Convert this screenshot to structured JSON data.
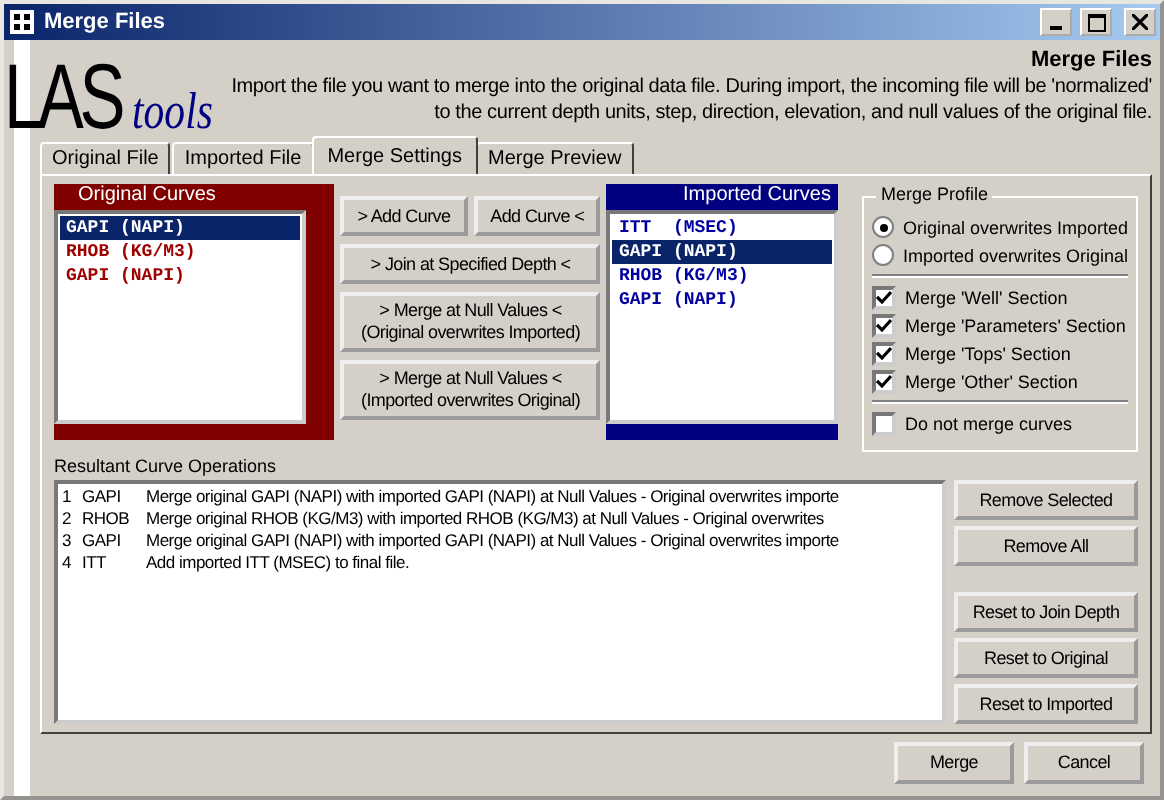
{
  "window": {
    "title": "Merge Files"
  },
  "logo": {
    "main": "LAS",
    "sub": "tools"
  },
  "header": {
    "title": "Merge Files",
    "description": "Import the file you want to merge into the original data file.  During import, the incoming file will be 'normalized' to the current depth units, step, direction, elevation, and null values of the original file."
  },
  "tabs": [
    {
      "label": "Original File",
      "selected": false
    },
    {
      "label": "Imported File",
      "selected": false
    },
    {
      "label": "Merge Settings",
      "selected": true
    },
    {
      "label": "Merge Preview",
      "selected": false
    }
  ],
  "original_curves": {
    "title": "Original Curves",
    "items": [
      {
        "label": "GAPI (NAPI)",
        "selected": true
      },
      {
        "label": "RHOB (KG/M3)",
        "selected": false
      },
      {
        "label": "GAPI (NAPI)",
        "selected": false
      }
    ]
  },
  "imported_curves": {
    "title": "Imported Curves",
    "items": [
      {
        "label": "ITT  (MSEC)",
        "selected": false
      },
      {
        "label": "GAPI (NAPI)",
        "selected": true
      },
      {
        "label": "RHOB (KG/M3)",
        "selected": false
      },
      {
        "label": "GAPI (NAPI)",
        "selected": false
      }
    ]
  },
  "curve_buttons": [
    [
      "> Add Curve",
      "Add Curve <"
    ],
    [
      "> Join at Specified Depth <"
    ],
    [
      "> Merge at Null Values <",
      "(Original overwrites Imported)"
    ],
    [
      "> Merge at Null Values <",
      "(Imported overwrites Original)"
    ]
  ],
  "merge_profile": {
    "title": "Merge Profile",
    "options": [
      {
        "kind": "radio",
        "label": "Original overwrites Imported",
        "selected": true
      },
      {
        "kind": "radio",
        "label": "Imported overwrites Original",
        "selected": false
      },
      {
        "kind": "separator"
      },
      {
        "kind": "checkbox",
        "label": "Merge 'Well' Section",
        "checked": true
      },
      {
        "kind": "checkbox",
        "label": "Merge 'Parameters' Section",
        "checked": true
      },
      {
        "kind": "checkbox",
        "label": "Merge 'Tops' Section",
        "checked": true
      },
      {
        "kind": "checkbox",
        "label": "Merge 'Other' Section",
        "checked": true
      },
      {
        "kind": "separator"
      },
      {
        "kind": "checkbox",
        "label": "Do not merge curves",
        "checked": false
      }
    ]
  },
  "operations": {
    "label": "Resultant Curve Operations",
    "rows": [
      {
        "number": "1",
        "curve": "GAPI",
        "description": "Merge original GAPI (NAPI) with imported GAPI (NAPI) at Null Values - Original overwrites importe"
      },
      {
        "number": "2",
        "curve": "RHOB",
        "description": "Merge original RHOB (KG/M3) with imported RHOB (KG/M3) at Null Values - Original overwrites"
      },
      {
        "number": "3",
        "curve": "GAPI",
        "description": "Merge original GAPI (NAPI) with imported GAPI (NAPI) at Null Values - Original overwrites importe"
      },
      {
        "number": "4",
        "curve": "ITT",
        "description": "Add imported ITT (MSEC) to final file."
      }
    ]
  },
  "operation_buttons": [
    [
      "Remove Selected",
      "Remove All"
    ],
    [
      "Reset to Join Depth",
      "Reset to Original",
      "Reset to Imported"
    ]
  ],
  "footer_buttons": [
    "Merge",
    "Cancel"
  ]
}
